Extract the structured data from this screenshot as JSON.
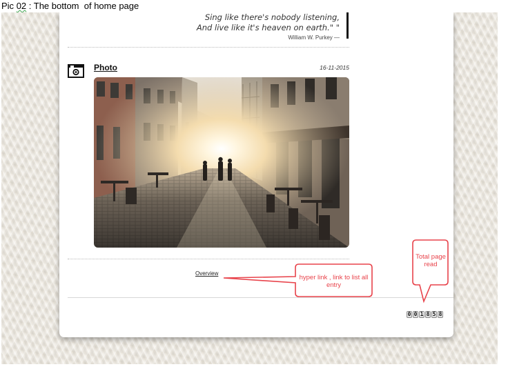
{
  "caption": {
    "prefix": "Pic",
    "number": "02",
    "rest": " : The bottom  of home page"
  },
  "quote": {
    "line1": "Sing like there's nobody listening,",
    "line2": "And live like it's heaven on earth.\" \"",
    "author": "William W. Purkey —"
  },
  "post": {
    "icon": "camera-icon",
    "title": "Photo",
    "date": "16-11-2015",
    "image_subject": "sunlit cobblestone street with cafes"
  },
  "overview_link": "Overview",
  "counter": {
    "digits": [
      "0",
      "0",
      "1",
      "8",
      "5",
      "8"
    ]
  },
  "annotations": {
    "link_callout": "hyper link , link to list all entry",
    "counter_callout": "Total page read",
    "color": "#e8424a"
  }
}
